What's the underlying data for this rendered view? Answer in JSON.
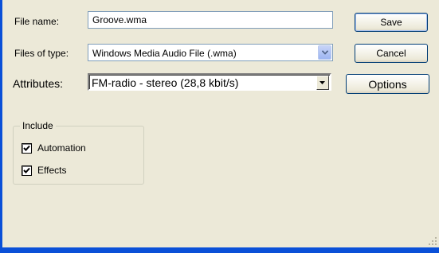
{
  "dialog": {
    "file_name_label": "File name:",
    "file_name_value": "Groove.wma",
    "files_of_type_label": "Files of type:",
    "files_of_type_value": "Windows Media Audio File (.wma)",
    "attributes_label": "Attributes:",
    "attributes_value": "FM-radio - stereo (28,8 kbit/s)",
    "save_label": "Save",
    "cancel_label": "Cancel",
    "options_label": "Options",
    "include": {
      "title": "Include",
      "items": [
        {
          "label": "Automation",
          "checked": true
        },
        {
          "label": "Effects",
          "checked": true
        }
      ]
    }
  },
  "colors": {
    "dialog_bg": "#ece9d8",
    "frame_blue": "#0a50d8",
    "field_border": "#7f9db9",
    "button_border": "#003c74"
  },
  "icons": [
    "chevron-down-icon",
    "checkmark-icon",
    "resize-grip-icon"
  ]
}
